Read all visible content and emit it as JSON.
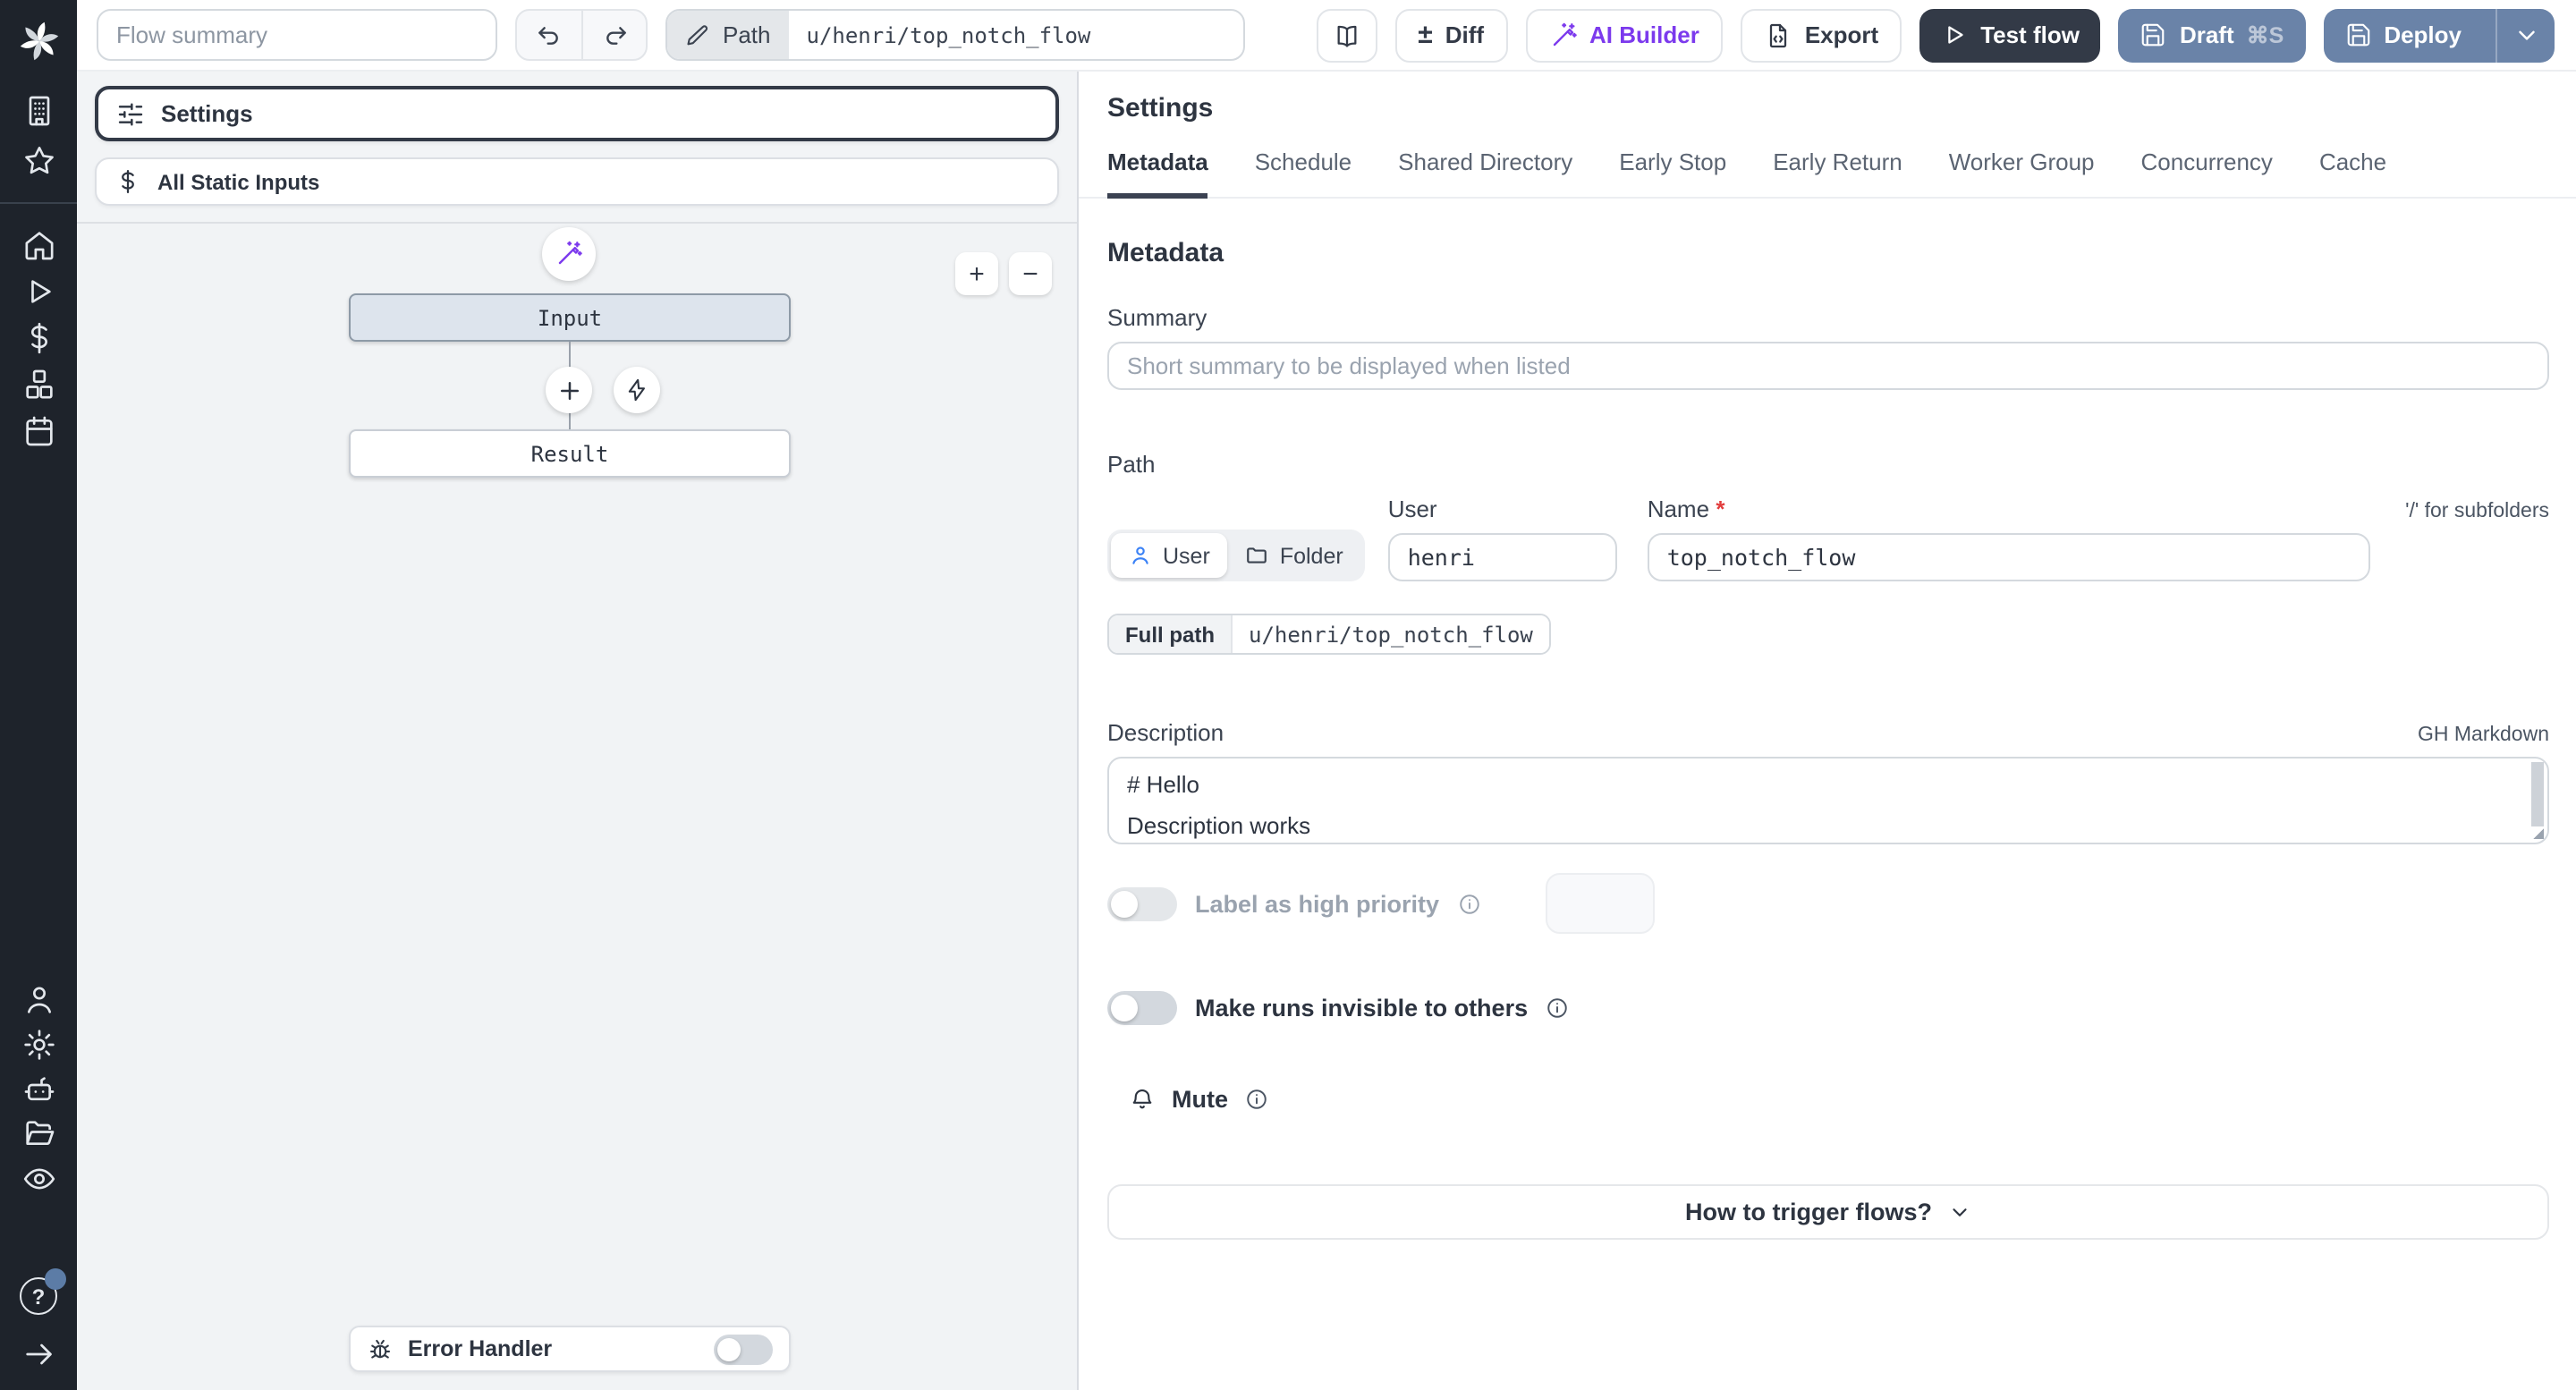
{
  "topbar": {
    "flow_summary_placeholder": "Flow summary",
    "path_label": "Path",
    "path_value": "u/henri/top_notch_flow",
    "diff_glyph": "±",
    "diff_label": "Diff",
    "ai_builder_label": "AI Builder",
    "export_label": "Export",
    "test_flow_label": "Test flow",
    "draft_label": "Draft",
    "draft_shortcut": "⌘S",
    "deploy_label": "Deploy"
  },
  "left": {
    "settings_card_label": "Settings",
    "static_inputs_label": "All Static Inputs",
    "input_node_label": "Input",
    "result_node_label": "Result",
    "zoom_in_glyph": "+",
    "zoom_out_glyph": "−",
    "error_handler_label": "Error Handler"
  },
  "panel": {
    "title": "Settings",
    "tabs": [
      "Metadata",
      "Schedule",
      "Shared Directory",
      "Early Stop",
      "Early Return",
      "Worker Group",
      "Concurrency",
      "Cache"
    ],
    "active_tab": "Metadata",
    "heading": "Metadata",
    "summary_label": "Summary",
    "summary_placeholder": "Short summary to be displayed when listed",
    "path_label": "Path",
    "segment_user": "User",
    "segment_folder": "Folder",
    "user_label": "User",
    "user_value": "henri",
    "name_label": "Name",
    "required_mark": "*",
    "subfolders_hint": "'/' for subfolders",
    "full_path_label": "Full path",
    "full_path_value": "u/henri/top_notch_flow",
    "description_label": "Description",
    "markdown_hint": "GH Markdown",
    "description_value": "# Hello\nDescription works",
    "high_priority_label": "Label as high priority",
    "invisible_label": "Make runs invisible to others",
    "mute_label": "Mute",
    "trigger_label": "How to trigger flows?"
  },
  "glyphs": {
    "help": "?"
  },
  "colors": {
    "sidebar_bg": "#1e232b",
    "accent_blue": "#3b82f6",
    "purple": "#7c3aed",
    "slate_button": "#6a83a8",
    "dark_button": "#333a47",
    "required_red": "#e23d3d"
  }
}
